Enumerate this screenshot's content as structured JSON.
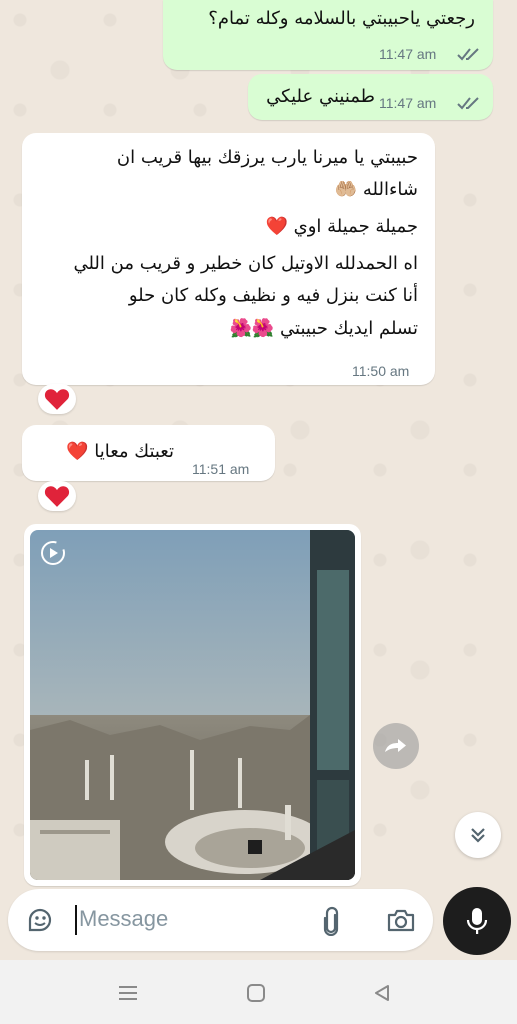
{
  "messages": [
    {
      "text": "رجعتي ياحبيبتي بالسلامه وكله تمام؟",
      "time": "11:47 am"
    },
    {
      "text": "طمنيني عليكي",
      "time": "11:47 am"
    }
  ],
  "incoming_long": {
    "lines": [
      "حبيبتي يا ميرنا يارب يرزقك بيها قريب ان",
      "شاءالله 🤲🏼",
      "جميلة جميلة اوي ❤️",
      "اه الحمدلله الاوتيل كان خطير و قريب من اللي",
      "أنا كنت بنزل فيه و نظيف وكله كان حلو",
      "تسلم ايديك حبيبتي 🌺🌺"
    ],
    "time": "11:50 am"
  },
  "incoming_short": {
    "text": "تعبتك معايا ❤️",
    "time": "11:51 am"
  },
  "composer": {
    "placeholder": "Message"
  },
  "colors": {
    "outgoing_bubble": "#d9fdd3",
    "incoming_bubble": "#ffffff",
    "wallpaper": "#efe7dd",
    "tick": "#667781",
    "heart": "#e0233a"
  },
  "icons": [
    "read-ticks-icon",
    "heart-reaction-icon",
    "video-play-icon",
    "forward-icon",
    "scroll-down-icon",
    "sticker-icon",
    "attach-icon",
    "camera-icon",
    "mic-icon",
    "nav-menu-icon",
    "nav-home-icon",
    "nav-back-icon"
  ]
}
